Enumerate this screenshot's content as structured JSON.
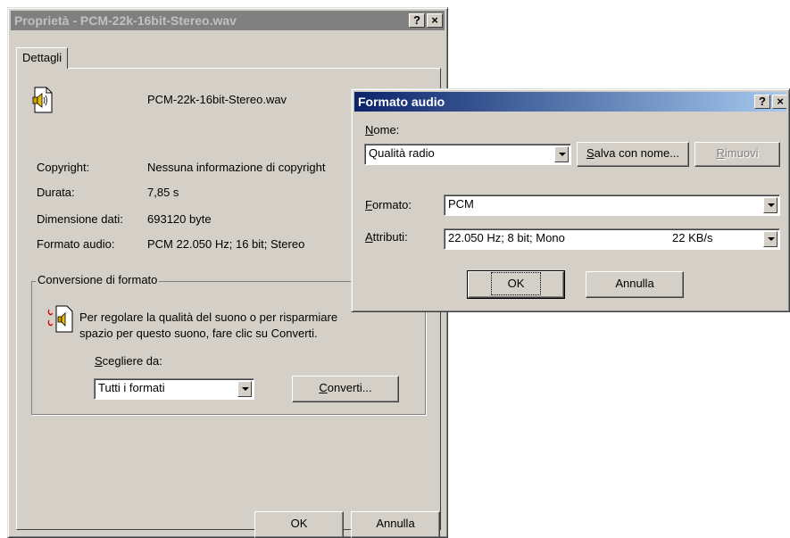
{
  "props_window": {
    "title": "Proprietà - PCM-22k-16bit-Stereo.wav",
    "help_btn": "?",
    "close_btn": "×",
    "tab_label": "Dettagli",
    "file_name": "PCM-22k-16bit-Stereo.wav",
    "rows": [
      {
        "label": "Copyright:",
        "value": "Nessuna informazione di copyright"
      },
      {
        "label": "Durata:",
        "value": "7,85 s"
      },
      {
        "label": "Dimensione dati:",
        "value": "693120 byte"
      },
      {
        "label": "Formato audio:",
        "value": "PCM 22.050 Hz; 16 bit; Stereo"
      }
    ],
    "group_title": "Conversione di formato",
    "conversion_text_1": "Per regolare la qualità del suono o per risparmiare",
    "conversion_text_2": "spazio per questo suono, fare clic su Converti.",
    "choose_label_u": "S",
    "choose_label_rest": "cegliere da:",
    "choose_value": "Tutti i formati",
    "convert_btn_u": "C",
    "convert_btn_rest": "onverti...",
    "ok_btn": "OK",
    "cancel_btn": "Annulla"
  },
  "format_dialog": {
    "title": "Formato audio",
    "help_btn": "?",
    "close_btn": "×",
    "name_label_u": "N",
    "name_label_rest": "ome:",
    "name_value": "Qualità radio",
    "save_as_btn_u": "S",
    "save_as_btn_rest": "alva con nome...",
    "remove_btn_u": "R",
    "remove_btn_rest": "imuovi",
    "format_label_u": "F",
    "format_label_rest": "ormato:",
    "format_value": "PCM",
    "attrs_label_u": "A",
    "attrs_label_rest": "ttributi:",
    "attrs_value": "22.050 Hz; 8 bit; Mono",
    "attrs_rate": "22 KB/s",
    "ok_btn": "OK",
    "cancel_btn": "Annulla"
  }
}
